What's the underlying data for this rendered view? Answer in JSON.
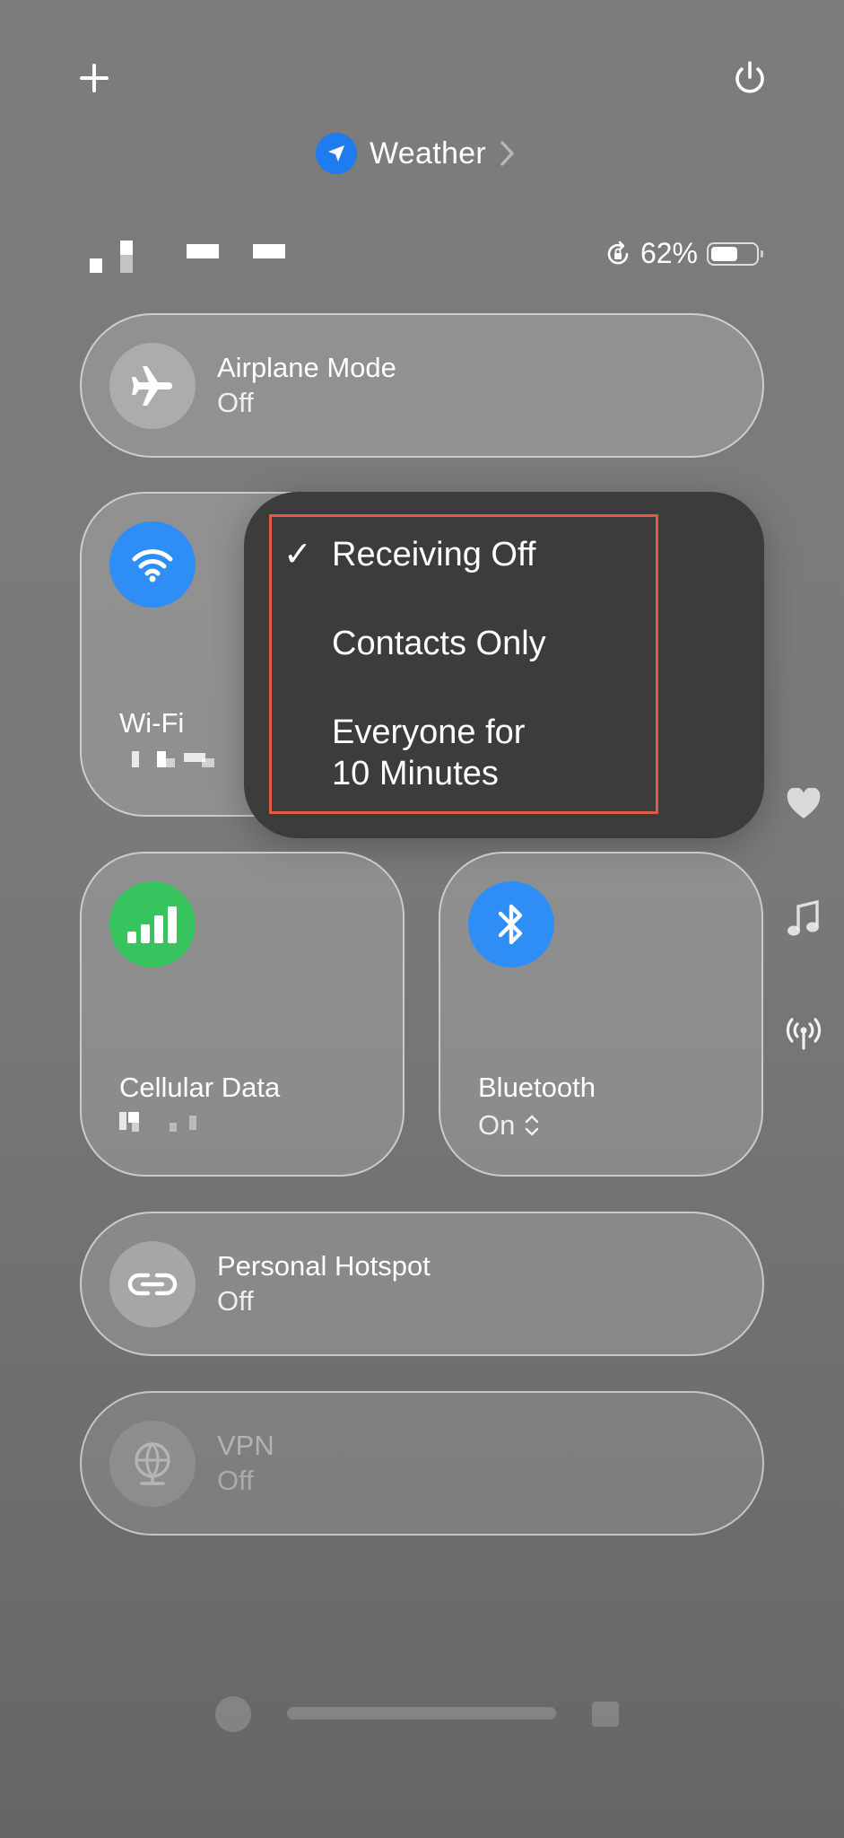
{
  "header": {
    "add_icon": "plus-icon",
    "power_icon": "power-icon",
    "location_app": "Weather",
    "location_icon": "location-arrow-icon",
    "chevron_icon": "chevron-right-icon"
  },
  "status": {
    "battery_percent": "62%",
    "battery_level": 0.62,
    "rotation_lock_icon": "rotation-lock-icon"
  },
  "airplane": {
    "label": "Airplane Mode",
    "state": "Off",
    "icon": "airplane-icon"
  },
  "wifi": {
    "label": "Wi-Fi",
    "icon": "wifi-icon",
    "accent": "#2e8ef6"
  },
  "airdrop_menu": {
    "items": [
      "Receiving Off",
      "Contacts Only",
      "Everyone for\n10 Minutes"
    ],
    "selected": "Receiving Off",
    "check": "✓",
    "highlight_color": "#e05a44"
  },
  "cellular": {
    "label": "Cellular Data",
    "icon": "cellular-bars-icon",
    "accent": "#37c35d"
  },
  "bluetooth": {
    "label": "Bluetooth",
    "state": "On",
    "icon": "bluetooth-icon",
    "accent": "#2e8ef6"
  },
  "hotspot": {
    "label": "Personal Hotspot",
    "state": "Off",
    "icon": "link-icon"
  },
  "vpn": {
    "label": "VPN",
    "state": "Off",
    "icon": "globe-icon"
  },
  "side_icons": [
    "heart-icon",
    "music-note-icon",
    "antenna-icon"
  ]
}
